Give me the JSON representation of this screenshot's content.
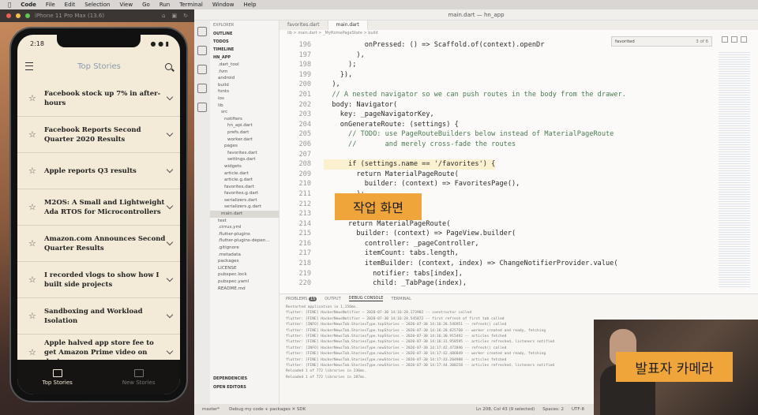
{
  "menubar": {
    "items": [
      "Code",
      "File",
      "Edit",
      "Selection",
      "View",
      "Go",
      "Run",
      "Terminal",
      "Window",
      "Help"
    ]
  },
  "simulator": {
    "title": "iPhone 11 Pro Max (13.6)",
    "time": "2:18",
    "app_title": "Top Stories",
    "stories": [
      "Facebook stock up 7% in after-hours",
      "Facebook Reports Second Quarter 2020 Results",
      "Apple reports Q3 results",
      "M2OS: A Small and Lightweight Ada RTOS for Microcontrollers",
      "Amazon.com Announces Second Quarter Results",
      "I recorded vlogs to show how I built side projects",
      "Sandboxing and Workload Isolation",
      "Apple halved app store fee to get Amazon Prime video on devices"
    ],
    "nav": {
      "top": "Top Stories",
      "new": "New Stories"
    }
  },
  "vscode": {
    "window_title": "main.dart — hn_app",
    "explorer": {
      "header": "EXPLORER",
      "sections": [
        "OUTLINE",
        "TODOS",
        "TIMELINE",
        "HN_APP"
      ],
      "tree": [
        ".dart_tool",
        ".fvm",
        "android",
        "build",
        "fonts",
        "ios",
        "lib",
        "src",
        "notifiers",
        "hn_api.dart",
        "prefs.dart",
        "worker.dart",
        "pages",
        "favorites.dart",
        "settings.dart",
        "widgets",
        "article.dart",
        "article.g.dart",
        "favorites.dart",
        "favorites.g.dart",
        "serializers.dart",
        "serializers.g.dart",
        "main.dart",
        "test",
        ".cirrus.yml",
        ".flutter-plugins",
        ".flutter-plugins-depen...",
        ".gitignore",
        ".metadata",
        "packages",
        "LICENSE",
        "pubspec.lock",
        "pubspec.yaml",
        "README.md"
      ],
      "footer": [
        "DEPENDENCIES",
        "OPEN EDITORS"
      ]
    },
    "tabs": [
      "favorites.dart",
      "main.dart"
    ],
    "breadcrumb": "lib > main.dart > _MyHomePageState > build",
    "find": {
      "value": "favorited",
      "count": "3 of 6"
    },
    "code": [
      {
        "n": "196",
        "t": "          onPressed: () => Scaffold.of(context).openDr"
      },
      {
        "n": "197",
        "t": "        ),"
      },
      {
        "n": "198",
        "t": "      );"
      },
      {
        "n": "199",
        "t": "    }),"
      },
      {
        "n": "200",
        "t": "  ),"
      },
      {
        "n": "201",
        "t": "  // A nested navigator so we can push routes in the body from the drawer."
      },
      {
        "n": "202",
        "t": "  body: Navigator("
      },
      {
        "n": "203",
        "t": "    key: _pageNavigatorKey,"
      },
      {
        "n": "204",
        "t": "    onGenerateRoute: (settings) {"
      },
      {
        "n": "205",
        "t": "      // TODO: use PageRouteBuilders below instead of MaterialPageRoute"
      },
      {
        "n": "206",
        "t": "      //       and merely cross-fade the routes"
      },
      {
        "n": "207",
        "t": ""
      },
      {
        "n": "208",
        "t": "      if (settings.name == '/favorites') {"
      },
      {
        "n": "209",
        "t": "        return MaterialPageRoute("
      },
      {
        "n": "210",
        "t": "          builder: (context) => FavoritesPage(),"
      },
      {
        "n": "211",
        "t": "        );"
      },
      {
        "n": "212",
        "t": "      }"
      },
      {
        "n": "213",
        "t": ""
      },
      {
        "n": "214",
        "t": "      return MaterialPageRoute("
      },
      {
        "n": "215",
        "t": "        builder: (context) => PageView.builder("
      },
      {
        "n": "216",
        "t": "          controller: _pageController,"
      },
      {
        "n": "217",
        "t": "          itemCount: tabs.length,"
      },
      {
        "n": "218",
        "t": "          itemBuilder: (context, index) => ChangeNotifierProvider.value("
      },
      {
        "n": "219",
        "t": "            notifier: tabs[index],"
      },
      {
        "n": "220",
        "t": "            child: _TabPage(index),"
      }
    ],
    "panel": {
      "tabs": [
        "PROBLEMS",
        "OUTPUT",
        "DEBUG CONSOLE",
        "TERMINAL"
      ],
      "problems_count": "15",
      "log": [
        "Restarted application in 1,156ms.",
        "flutter: [FINE] HackerNewsNotifier — 2020-07-30 14:16:28.173982 -- constructor called",
        "flutter: [FINE] HackerNewsNotifier — 2020-07-30 14:16:28.545872 -- first refresh of first tab called",
        "flutter: [INFO] HackerNewsTab.StoriesType.topStories — 2020-07-30 14:16:28.546951 -- refresh() called",
        "flutter: [FINE] HackerNewsTab.StoriesType.topStories — 2020-07-30 14:16:28.825760 -- worker created and ready, fetching",
        "flutter: [FINE] HackerNewsTab.StoriesType.topStories — 2020-07-30 14:16:30.915492 -- articles fetched",
        "flutter: [FINE] HackerNewsTab.StoriesType.topStories — 2020-07-30 14:16:31.958595 -- articles refreshed, listeners notified",
        "flutter: [INFO] HackerNewsTab.StoriesType.newStories — 2020-07-30 14:17:42.472846 -- refresh() called",
        "flutter: [FINE] HackerNewsTab.StoriesType.newStories — 2020-07-30 14:17:42.486849 -- worker created and ready, fetching",
        "flutter: [FINE] HackerNewsTab.StoriesType.newStories — 2020-07-30 14:17:43.204988 -- articles fetched",
        "flutter: [FINE] HackerNewsTab.StoriesType.newStories — 2020-07-30 14:17:44.380258 -- articles refreshed, listeners notified",
        "Reloaded 1 of 772 libraries in 236ms.",
        "Reloaded 1 of 772 libraries in 287ms."
      ]
    },
    "statusbar": {
      "branch": "master*",
      "debug": "Debug my code + packages ✕ SDK",
      "position": "Ln 208, Col 43 (9 selected)",
      "spaces": "Spaces: 2",
      "encoding": "UTF-8"
    }
  },
  "overlays": {
    "work_screen": "작업 화면",
    "presenter_camera": "발표자 카메라"
  },
  "colors": {
    "callout": "#f0a53a",
    "app_bg": "#f3ead7",
    "bottom_nav": "#161412"
  }
}
